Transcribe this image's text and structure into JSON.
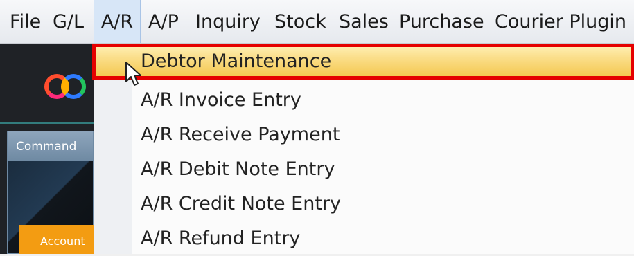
{
  "menubar": {
    "items": [
      "File",
      "G/L",
      "A/R",
      "A/P",
      "Inquiry",
      "Stock",
      "Sales",
      "Purchase",
      "Courier Plugin"
    ],
    "active": "A/R"
  },
  "sidebar": {
    "panel_title": "Command",
    "button_label": "Account"
  },
  "dropdown": {
    "items": [
      "Debtor Maintenance",
      "A/R Invoice Entry",
      "A/R Receive Payment",
      "A/R Debit Note Entry",
      "A/R Credit Note Entry",
      "A/R Refund Entry"
    ],
    "highlighted": "Debtor Maintenance"
  },
  "colors": {
    "highlight_outline": "#e50000",
    "hover_fill": "#f9d87a",
    "accent_button": "#f39c12"
  }
}
